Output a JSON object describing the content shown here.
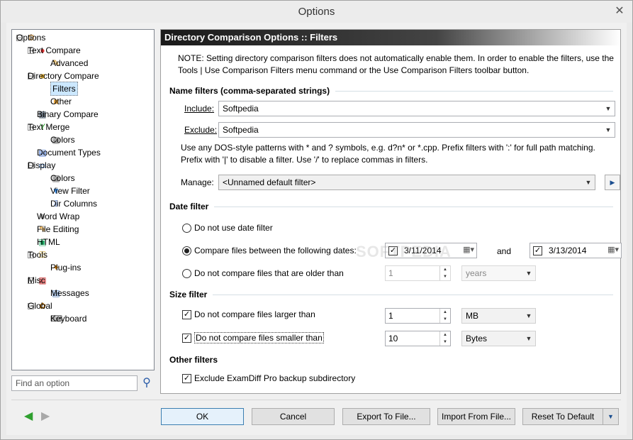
{
  "window": {
    "title": "Options"
  },
  "tree": {
    "items": [
      {
        "label": "Options",
        "icon": "gear-icon",
        "glyph": "⚙",
        "color": "#b07a2a"
      },
      {
        "label": "Text Compare",
        "icon": "fruit-icon",
        "glyph": "●",
        "color": "#d33"
      },
      {
        "label": "Advanced",
        "icon": "wand-icon",
        "glyph": "✎",
        "color": "#c80"
      },
      {
        "label": "Directory Compare",
        "icon": "folder-icon",
        "glyph": "■",
        "color": "#e3b23c"
      },
      {
        "label": "Filters",
        "icon": "filter-icon",
        "glyph": "▼",
        "color": "#d22"
      },
      {
        "label": "Other",
        "icon": "folder-gear-icon",
        "glyph": "■",
        "color": "#e3a33c"
      },
      {
        "label": "Binary Compare",
        "icon": "binary-icon",
        "glyph": "▦",
        "color": "#345"
      },
      {
        "label": "Text Merge",
        "icon": "merge-icon",
        "glyph": "Y",
        "color": "#3a3"
      },
      {
        "label": "Colors",
        "icon": "palette-grid-icon",
        "glyph": "▦",
        "color": "#777"
      },
      {
        "label": "Document Types",
        "icon": "document-types-icon",
        "glyph": "▤",
        "color": "#36c"
      },
      {
        "label": "Display",
        "icon": "monitor-icon",
        "glyph": "▭",
        "color": "#2b6cc4"
      },
      {
        "label": "Colors",
        "icon": "palette-grid-icon",
        "glyph": "▦",
        "color": "#777"
      },
      {
        "label": "View Filter",
        "icon": "funnel-icon",
        "glyph": "▼",
        "color": "#3a8ee8"
      },
      {
        "label": "Dir Columns",
        "icon": "columns-icon",
        "glyph": "⇩",
        "color": "#36c"
      },
      {
        "label": "Word Wrap",
        "icon": "word-wrap-icon",
        "glyph": "≡",
        "color": "#333"
      },
      {
        "label": "File Editing",
        "icon": "pencil-icon",
        "glyph": "✎",
        "color": "#d80"
      },
      {
        "label": "HTML",
        "icon": "html-icon",
        "glyph": "▣",
        "color": "#2a6"
      },
      {
        "label": "Tools",
        "icon": "key-icon",
        "glyph": "⚿",
        "color": "#c90"
      },
      {
        "label": "Plug-ins",
        "icon": "plugin-icon",
        "glyph": "✦",
        "color": "#c70"
      },
      {
        "label": "Misc",
        "icon": "misc-grid-icon",
        "glyph": "▦",
        "color": "#c33"
      },
      {
        "label": "Messages",
        "icon": "messages-icon",
        "glyph": "▤",
        "color": "#36a"
      },
      {
        "label": "Global",
        "icon": "global-icon",
        "glyph": "✿",
        "color": "#a60"
      },
      {
        "label": "Keyboard",
        "icon": "keyboard-icon",
        "glyph": "⌨",
        "color": "#555"
      }
    ]
  },
  "find": {
    "placeholder": "Find an option"
  },
  "panel": {
    "header": "Directory Comparison Options :: Filters",
    "note": "NOTE: Setting directory comparison filters does not automatically enable them. In order to enable the filters, use the Tools | Use Comparison Filters menu command or the Use Comparison Filters toolbar button.",
    "name_filters": {
      "title": "Name filters (comma-separated strings)",
      "include_label": "Include:",
      "include_value": "Softpedia",
      "exclude_label": "Exclude:",
      "exclude_value": "Softpedia",
      "help": "Use any DOS-style patterns with * and ? symbols, e.g. d?n* or *.cpp. Prefix filters with ':' for full path matching. Prefix with '|' to disable a filter. Use '/' to replace commas in filters.",
      "manage_label": "Manage:",
      "manage_value": "<Unnamed default filter>"
    },
    "date_filter": {
      "title": "Date filter",
      "opt_none": "Do not use date filter",
      "opt_between": "Compare files between the following dates:",
      "date_from": "3/11/2014",
      "and_label": "and",
      "date_to": "3/13/2014",
      "opt_older": "Do not compare files that are older than",
      "older_value": "1",
      "older_unit": "years"
    },
    "size_filter": {
      "title": "Size filter",
      "larger_label": "Do not compare files larger than",
      "larger_value": "1",
      "larger_unit": "MB",
      "smaller_label": "Do not compare files smaller than",
      "smaller_value": "10",
      "smaller_unit": "Bytes"
    },
    "other_filters": {
      "title": "Other filters",
      "exclude_backup": "Exclude ExamDiff Pro backup subdirectory"
    }
  },
  "buttons": {
    "ok": "OK",
    "cancel": "Cancel",
    "export": "Export To File...",
    "import": "Import From File...",
    "reset": "Reset To Default"
  },
  "watermark": "SOFTPEDIA"
}
